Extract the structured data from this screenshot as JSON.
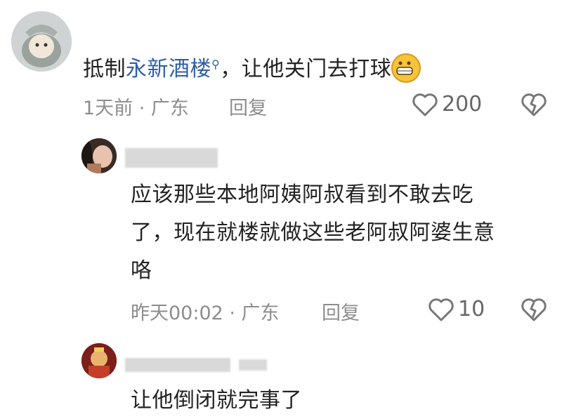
{
  "comments": [
    {
      "text_prefix": "抵制",
      "link_text": "永新酒楼",
      "text_suffix": "，让他关门去打球",
      "emoji": "grinning-face",
      "meta": "1天前 · 广东",
      "reply_label": "回复",
      "likes": "200"
    },
    {
      "line1": "应该那些本地阿姨阿叔看到不敢去吃",
      "line2": "了，现在就楼就做这些老阿叔阿婆生意",
      "line3": "咯",
      "meta": "昨天00:02 · 广东",
      "reply_label": "回复",
      "likes": "10"
    },
    {
      "text": "让他倒闭就完事了"
    }
  ],
  "colors": {
    "link": "#2f5fa8",
    "meta": "#8d8d8d",
    "text": "#222222"
  }
}
